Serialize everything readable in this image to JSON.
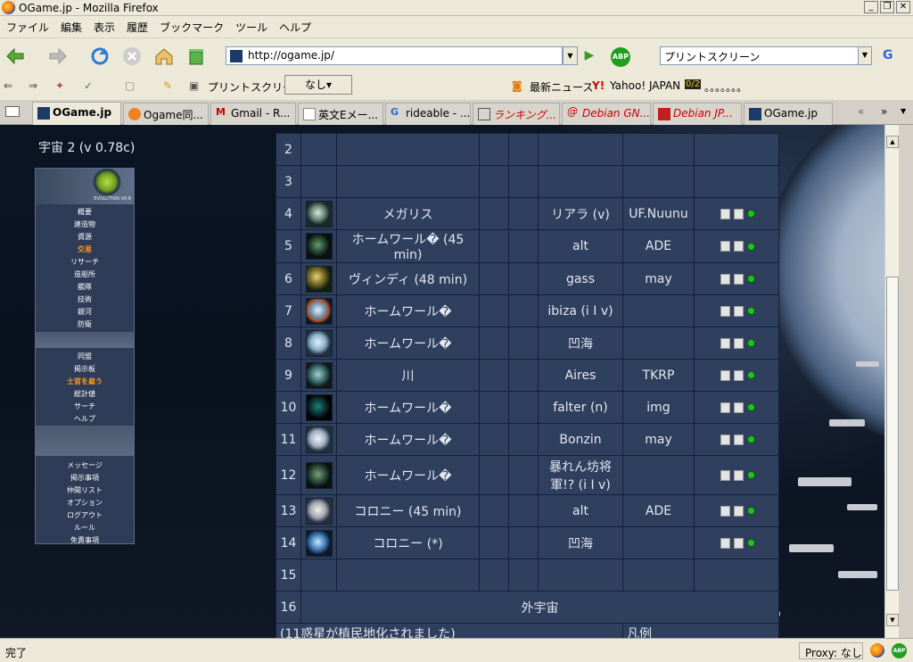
{
  "window": {
    "title": "OGame.jp - Mozilla Firefox"
  },
  "menubar": [
    "ファイル",
    "編集",
    "表示",
    "履歴",
    "ブックマーク",
    "ツール",
    "ヘルプ"
  ],
  "nav": {
    "url": "http://ogame.jp/",
    "search": "プリントスクリーン"
  },
  "bookmarks": {
    "print_screen": "プリントスクリーン",
    "none_button": "なし▾",
    "news": "最新ニュース",
    "yahoo": "Yahoo! JAPAN",
    "dots": "。。。。。。。"
  },
  "tabs": [
    {
      "label": "OGame.jp",
      "active": true
    },
    {
      "label": "Ogame同..."
    },
    {
      "label": "Gmail - R..."
    },
    {
      "label": "英文Eメー..."
    },
    {
      "label": "rideable - ..."
    },
    {
      "label": "ランキング..."
    },
    {
      "label": "Debian GN..."
    },
    {
      "label": "Debian JP..."
    },
    {
      "label": "OGame.jp"
    }
  ],
  "leftmenu": {
    "universe": "宇宙 2 (v 0.78c)",
    "logo_text": "EVOLUTION V0.8",
    "group1": [
      "概要",
      "建造物",
      "資源",
      "交易",
      "リサーチ",
      "造船所",
      "艦隊",
      "技術",
      "銀河",
      "防衛"
    ],
    "group2": [
      "同盟",
      "掲示板",
      "士官を雇う",
      "総計値",
      "サーチ",
      "ヘルプ"
    ],
    "group3": [
      "メッセージ",
      "掲示事項",
      "仲間リスト",
      "オプション",
      "ログアウト",
      "ルール",
      "免責事項"
    ]
  },
  "galaxy": {
    "rows": [
      {
        "pos": "2",
        "planet": "",
        "player": "",
        "alliance": ""
      },
      {
        "pos": "3",
        "planet": "",
        "player": "",
        "alliance": ""
      },
      {
        "pos": "4",
        "planet": "メガリス",
        "player": "リアラ (v)",
        "alliance": "UF.Nuunu"
      },
      {
        "pos": "5",
        "planet": "ホームワール� (45 min)",
        "player": "alt",
        "alliance": "ADE"
      },
      {
        "pos": "6",
        "planet": "ヴィンディ (48 min)",
        "player": "gass",
        "alliance": "may"
      },
      {
        "pos": "7",
        "planet": "ホームワール�",
        "player": "ibiza (i I v)",
        "alliance": ""
      },
      {
        "pos": "8",
        "planet": "ホームワール�",
        "player": "凹海",
        "alliance": ""
      },
      {
        "pos": "9",
        "planet": "川",
        "player": "Aires",
        "alliance": "TKRP"
      },
      {
        "pos": "10",
        "planet": "ホームワール�",
        "player": "falter (n)",
        "alliance": "img"
      },
      {
        "pos": "11",
        "planet": "ホームワール�",
        "player": "Bonzin",
        "alliance": "may"
      },
      {
        "pos": "12",
        "planet": "ホームワール�",
        "player": "暴れん坊将軍!? (i I v)",
        "alliance": ""
      },
      {
        "pos": "13",
        "planet": "コロニー (45 min)",
        "player": "alt",
        "alliance": "ADE"
      },
      {
        "pos": "14",
        "planet": "コロニー (*)",
        "player": "凹海",
        "alliance": ""
      },
      {
        "pos": "15",
        "planet": "",
        "player": "",
        "alliance": ""
      }
    ],
    "outer_pos": "16",
    "outer_label": "外宇宙",
    "footer_colonized": "(11惑星が植民地化されました)",
    "footer_legend": "凡例"
  },
  "status": {
    "text": "完了",
    "proxy": "Proxy: なし"
  }
}
